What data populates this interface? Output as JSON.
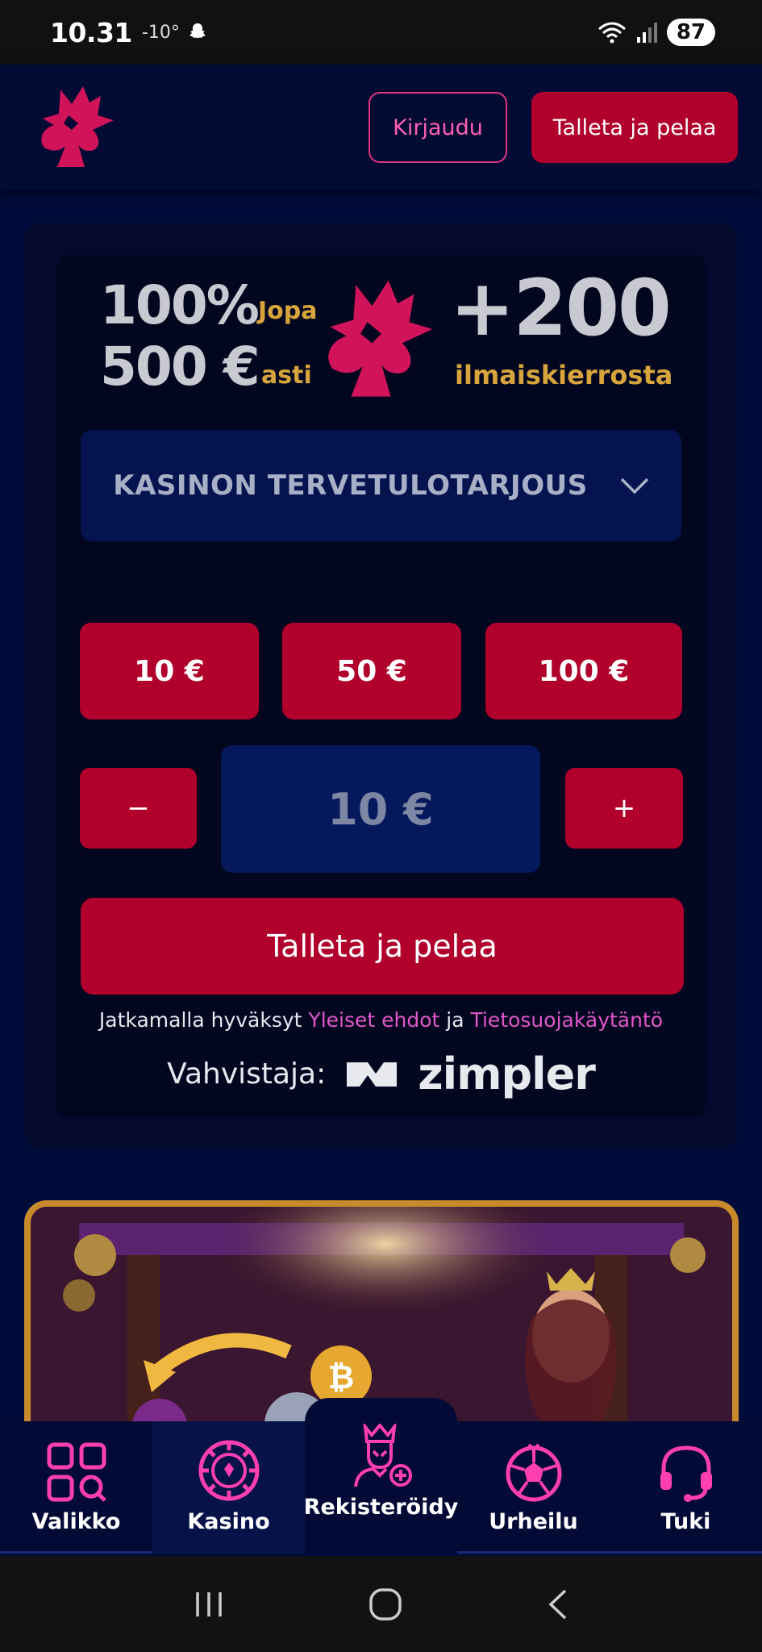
{
  "status_bar": {
    "time": "10.31",
    "temperature": "-10°",
    "battery": "87"
  },
  "header": {
    "login_label": "Kirjaudu",
    "deposit_label": "Talleta ja pelaa"
  },
  "promo": {
    "percent": "100%",
    "upto": "Jopa",
    "amount": "500 €",
    "amount_suffix": "asti",
    "spins": "+200",
    "spins_label": "ilmaiskierrosta"
  },
  "offer_select": {
    "selected": "KASINON TERVETULOTARJOUS",
    "icon": "chevron-down-icon"
  },
  "amount_options": [
    "10 €",
    "50 €",
    "100 €"
  ],
  "stepper": {
    "minus": "−",
    "plus": "+",
    "value": "10 €"
  },
  "deposit_button": "Talleta ja pelaa",
  "terms": {
    "prefix": "Jatkamalla hyväksyt",
    "link1": "Yleiset ehdot",
    "middle": "ja",
    "link2": "Tietosuojakäytäntö"
  },
  "verifier": {
    "label": "Vahvistaja:",
    "brand": "zimpler"
  },
  "bottom_nav": {
    "items": [
      {
        "label": "Valikko",
        "icon": "grid-search-icon"
      },
      {
        "label": "Kasino",
        "icon": "casino-chip-icon"
      },
      {
        "label": "Rekisteröidy",
        "icon": "register-king-icon"
      },
      {
        "label": "Urheilu",
        "icon": "football-icon"
      },
      {
        "label": "Tuki",
        "icon": "headset-icon"
      }
    ]
  },
  "colors": {
    "background": "#000c3a",
    "accent_red": "#b0002b",
    "accent_pink": "#e0337f",
    "link_pink": "#e057c8",
    "gold": "#d8a53c"
  }
}
